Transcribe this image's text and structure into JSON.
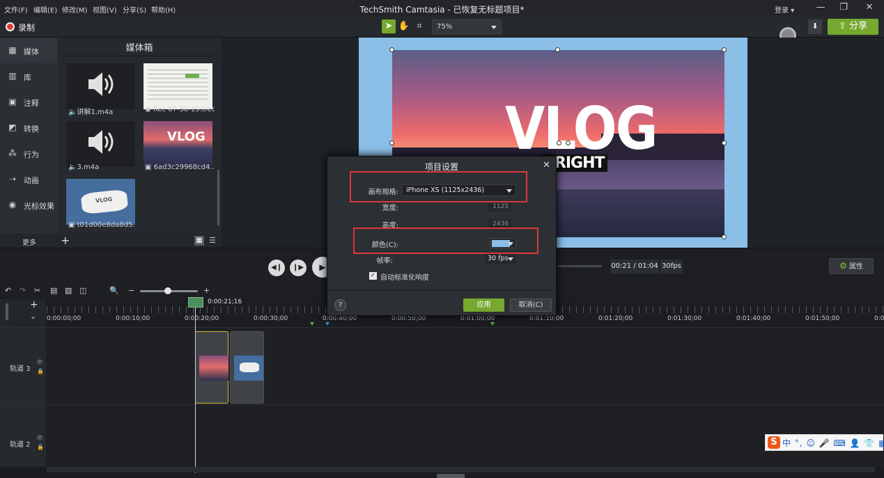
{
  "menu": [
    "文件(F)",
    "编辑(E)",
    "修改(M)",
    "视图(V)",
    "分享(S)",
    "帮助(H)"
  ],
  "app_title": "TechSmith Camtasia - 已恢复无标题项目*",
  "login": "登录 ▾",
  "toolbar": {
    "record_label": "录制",
    "zoom": "75%",
    "share_label": "分享"
  },
  "sidebar": {
    "items": [
      {
        "label": "媒体",
        "icon": "media-icon"
      },
      {
        "label": "库",
        "icon": "library-icon"
      },
      {
        "label": "注释",
        "icon": "annotation-icon"
      },
      {
        "label": "转换",
        "icon": "transition-icon"
      },
      {
        "label": "行为",
        "icon": "behavior-icon"
      },
      {
        "label": "动画",
        "icon": "animation-icon"
      },
      {
        "label": "光标效果",
        "icon": "cursor-effect-icon"
      }
    ],
    "more": "更多"
  },
  "media_bin": {
    "title": "媒体箱",
    "items": [
      {
        "label": "讲解1.m4a",
        "type": "audio"
      },
      {
        "label": "Rec 07-30-19.trec",
        "type": "recording"
      },
      {
        "label": "3.m4a",
        "type": "audio"
      },
      {
        "label": "6ad3c29968cd4...",
        "type": "image"
      },
      {
        "label": "t01d00e8da8d5...",
        "type": "image"
      }
    ]
  },
  "canvas": {
    "vlog_title": "VLOG",
    "vlog_subtitle": "YRIGHT",
    "background_color": "#8cbfe8"
  },
  "playback": {
    "time": "00:21 / 01:04",
    "fps": "30fps",
    "properties_label": "属性"
  },
  "timeline": {
    "playhead_time": "0:00:21;16",
    "ticks": [
      "0:00:00;00",
      "0:00:10;00",
      "0:00:20;00",
      "0:00:30;00",
      "0:00:40;00",
      "0:00:50;00",
      "0:01:00;00",
      "0:01:10;00",
      "0:01:20;00",
      "0:01:30;00",
      "0:01:40;00",
      "0:01:50;00",
      "0:0"
    ],
    "tracks": [
      {
        "label": "轨道 3"
      },
      {
        "label": "轨道 2"
      }
    ],
    "vlog_clip_text": "VLOG"
  },
  "dialog": {
    "title": "项目设置",
    "canvas_size_label": "画布规格:",
    "canvas_size_value": "iPhone XS (1125x2436)",
    "width_label": "宽度:",
    "width_value": "1125",
    "height_label": "高度:",
    "height_value": "2436",
    "color_label": "颜色(C):",
    "color_value": "#8cbfe8",
    "fps_label": "帧率:",
    "fps_value": "30 fps",
    "auto_normalize_label": "自动标准化响度",
    "auto_normalize_checked": true,
    "apply_label": "应用",
    "cancel_label": "取消(C)",
    "help_label": "?"
  },
  "ime": {
    "logo": "S",
    "text": "中 °, ☺ 🎤 ⌨ 👤 👕 ▦"
  }
}
